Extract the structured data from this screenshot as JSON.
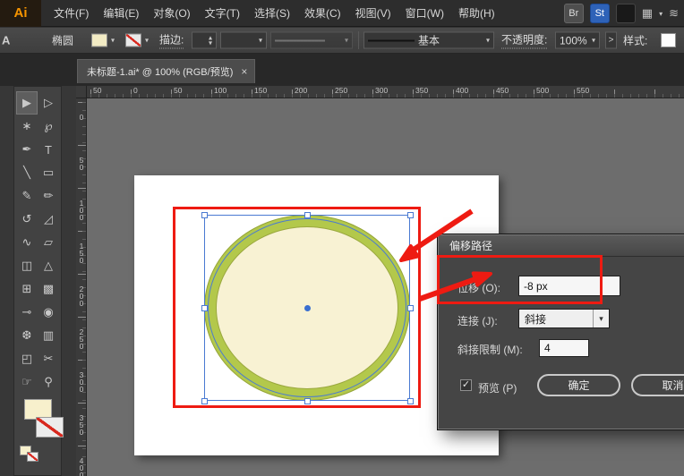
{
  "menubar": {
    "logo": "Ai",
    "items": [
      "文件(F)",
      "编辑(E)",
      "对象(O)",
      "文字(T)",
      "选择(S)",
      "效果(C)",
      "视图(V)",
      "窗口(W)",
      "帮助(H)"
    ],
    "right": {
      "bridge": "Br",
      "stock": "St",
      "workspace_glyph": "▦",
      "live_glyph": "≋"
    }
  },
  "control_bar": {
    "edge_label": "A",
    "tool_name": "椭圆",
    "stroke_label": "描边:",
    "brush_name": "基本",
    "opacity_label": "不透明度:",
    "opacity_value": "100%",
    "more_glyph": ">",
    "style_label": "样式:"
  },
  "icons": {
    "caret": "▾",
    "stepper_up": "▴",
    "stepper_down": "▾",
    "close": "×",
    "collapse": "«",
    "check": "✓"
  },
  "tab": {
    "title": "未标题-1.ai* @ 100% (RGB/预览)",
    "close": "×"
  },
  "rulers": {
    "horizontal": [
      "50",
      "0",
      "50",
      "100",
      "150",
      "200",
      "250",
      "300",
      "350",
      "400",
      "450",
      "500",
      "550"
    ],
    "vertical": [
      "0",
      "50",
      "100",
      "150",
      "200",
      "250",
      "300",
      "350",
      "400"
    ]
  },
  "toolbar": {
    "tools": [
      {
        "name": "selection-tool-icon",
        "glyph": "▶",
        "active": true
      },
      {
        "name": "direct-selection-tool-icon",
        "glyph": "▷"
      },
      {
        "name": "magic-wand-tool-icon",
        "glyph": "∗"
      },
      {
        "name": "lasso-tool-icon",
        "glyph": "℘"
      },
      {
        "name": "pen-tool-icon",
        "glyph": "✒"
      },
      {
        "name": "type-tool-icon",
        "glyph": "T"
      },
      {
        "name": "line-tool-icon",
        "glyph": "╲"
      },
      {
        "name": "rectangle-tool-icon",
        "glyph": "▭"
      },
      {
        "name": "paintbrush-tool-icon",
        "glyph": "✎"
      },
      {
        "name": "pencil-tool-icon",
        "glyph": "✏"
      },
      {
        "name": "rotate-tool-icon",
        "glyph": "↺"
      },
      {
        "name": "scale-tool-icon",
        "glyph": "◿"
      },
      {
        "name": "width-tool-icon",
        "glyph": "∿"
      },
      {
        "name": "free-transform-tool-icon",
        "glyph": "▱"
      },
      {
        "name": "shape-builder-tool-icon",
        "glyph": "◫"
      },
      {
        "name": "perspective-grid-tool-icon",
        "glyph": "△"
      },
      {
        "name": "mesh-tool-icon",
        "glyph": "⊞"
      },
      {
        "name": "gradient-tool-icon",
        "glyph": "▩"
      },
      {
        "name": "eyedropper-tool-icon",
        "glyph": "⊸"
      },
      {
        "name": "blend-tool-icon",
        "glyph": "◉"
      },
      {
        "name": "symbol-sprayer-tool-icon",
        "glyph": "❆"
      },
      {
        "name": "column-graph-tool-icon",
        "glyph": "▥"
      },
      {
        "name": "artboard-tool-icon",
        "glyph": "◰"
      },
      {
        "name": "slice-tool-icon",
        "glyph": "✂"
      },
      {
        "name": "hand-tool-icon",
        "glyph": "☞"
      },
      {
        "name": "zoom-tool-icon",
        "glyph": "⚲"
      }
    ]
  },
  "dialog": {
    "title": "偏移路径",
    "offset_label": "位移 (O):",
    "offset_value": "-8 px",
    "join_label": "连接 (J):",
    "join_value": "斜接",
    "miter_label": "斜接限制 (M):",
    "miter_value": "4",
    "preview_label": "预览 (P)",
    "ok_label": "确定",
    "cancel_label": "取消"
  },
  "colors": {
    "annotation_red": "#ee1b12",
    "selection_blue": "#4a7ad2",
    "ellipse_fill": "#f8f2d3",
    "ellipse_stroke": "#b3c84b"
  }
}
